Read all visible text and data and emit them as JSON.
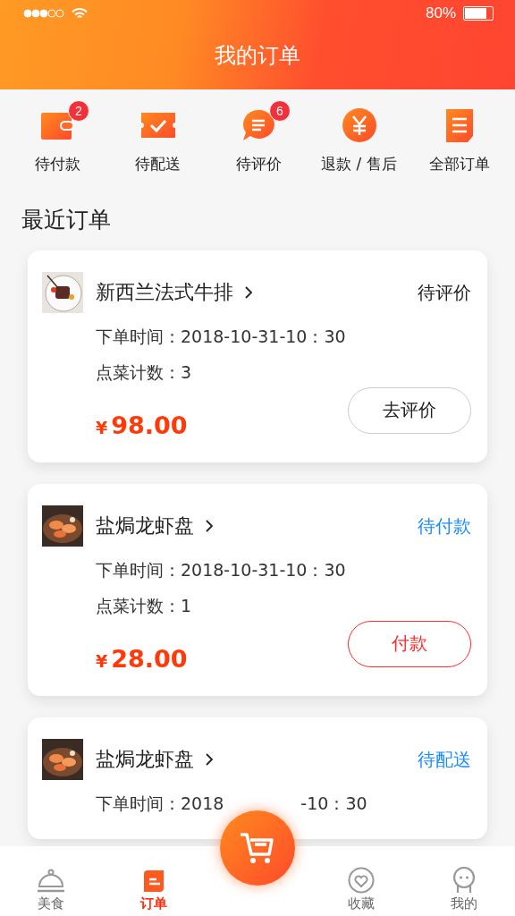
{
  "status_bar": {
    "battery_text": "80%"
  },
  "header": {
    "title": "我的订单"
  },
  "shortcuts": [
    {
      "kind": "wallet",
      "label": "待付款",
      "badge": "2"
    },
    {
      "kind": "ticket",
      "label": "待配送"
    },
    {
      "kind": "chat",
      "label": "待评价",
      "badge": "6"
    },
    {
      "kind": "yen",
      "label": "退款 / 售后"
    },
    {
      "kind": "doc",
      "label": "全部订单"
    }
  ],
  "section_title": "最近订单",
  "orders": [
    {
      "kind": "steak",
      "name": "新西兰法式牛排",
      "status": "待评价",
      "color": "#222222",
      "time_parts": [
        "下单时间：2018-10-31-10：30"
      ],
      "count": "点菜计数：3",
      "currency": "¥",
      "price": "98.00",
      "action": {
        "kind": "outline",
        "label": "去评价"
      }
    },
    {
      "kind": "shrimp",
      "name": "盐焗龙虾盘",
      "status": "待付款",
      "color": "#1a8cff",
      "time_parts": [
        "下单时间：2018-10-31-10：30"
      ],
      "count": "点菜计数：1",
      "currency": "¥",
      "price": "28.00",
      "action": {
        "kind": "pay",
        "label": "付款"
      }
    },
    {
      "kind": "shrimp",
      "name": "盐焗龙虾盘",
      "status": "待配送",
      "color": "#1a8cff",
      "time_parts": [
        "下单时间：2018",
        "-10：30"
      ]
    }
  ],
  "tab_bar": [
    {
      "kind": "dish",
      "label": "美食",
      "selected": false
    },
    {
      "kind": "order",
      "label": "订单",
      "selected": true
    },
    {
      "kind": "cart"
    },
    {
      "kind": "heart",
      "label": "收藏",
      "selected": false
    },
    {
      "kind": "face",
      "label": "我的",
      "selected": false
    }
  ]
}
